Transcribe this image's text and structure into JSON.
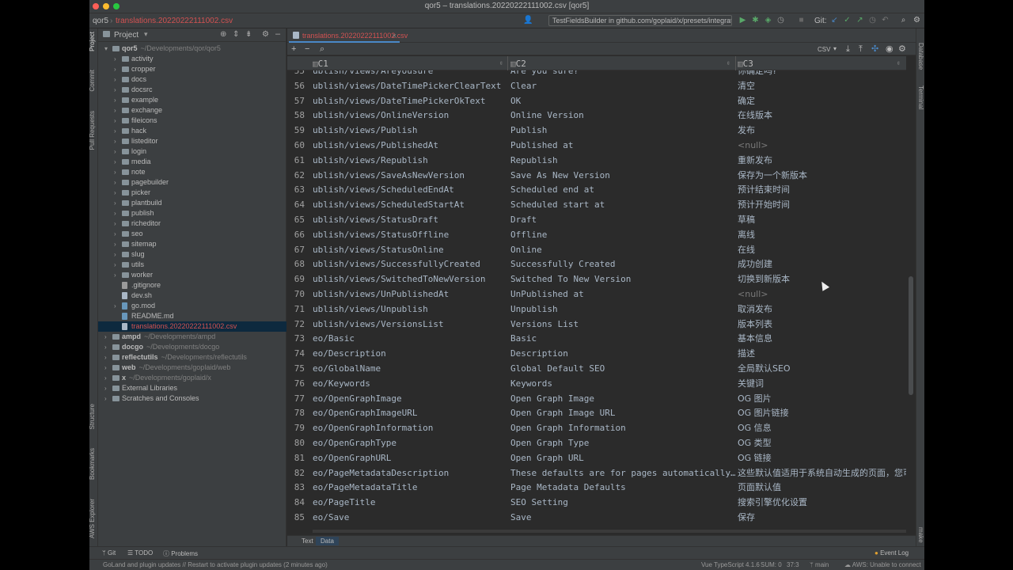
{
  "window": {
    "title": "qor5 – translations.20220222111002.csv [qor5]",
    "breadcrumb_project": "qor5",
    "breadcrumb_file": "translations.20220222111002.csv",
    "run_config": "TestFieldsBuilder in github.com/goplaid/x/presets/integration",
    "git_label": "Git:"
  },
  "left_strip": [
    "Project",
    "Commit",
    "Pull Requests",
    "Structure",
    "Bookmarks",
    "AWS Explorer"
  ],
  "right_strip": [
    "Database",
    "Terminal",
    "make"
  ],
  "project_panel": {
    "title": "Project",
    "root": {
      "name": "qor5",
      "path": "~/Developments/qor/qor5"
    },
    "folders": [
      "activity",
      "cropper",
      "docs",
      "docsrc",
      "example",
      "exchange",
      "fileicons",
      "hack",
      "listeditor",
      "login",
      "media",
      "note",
      "pagebuilder",
      "picker",
      "plantbuild",
      "publish",
      "richeditor",
      "seo",
      "sitemap",
      "slug",
      "utils",
      "worker"
    ],
    "files": [
      ".gitignore",
      "dev.sh",
      "go.mod",
      "README.md",
      "translations.20220222111002.csv"
    ],
    "other_roots": [
      {
        "name": "ampd",
        "path": "~/Developments/ampd"
      },
      {
        "name": "docgo",
        "path": "~/Developments/docgo"
      },
      {
        "name": "reflectutils",
        "path": "~/Developments/reflectutils"
      },
      {
        "name": "web",
        "path": "~/Developments/goplaid/web"
      },
      {
        "name": "x",
        "path": "~/Developments/goplaid/x"
      }
    ],
    "extras": [
      "External Libraries",
      "Scratches and Consoles"
    ]
  },
  "editor": {
    "tab_label": "translations.20220222111002.csv",
    "format": "CSV",
    "columns": [
      "C1",
      "C2",
      "C3"
    ],
    "rows": [
      {
        "n": "55",
        "c1": "ublish/views/Areyousure",
        "c2": "Are you sure?",
        "c3": "你确定吗?"
      },
      {
        "n": "56",
        "c1": "ublish/views/DateTimePickerClearText",
        "c2": "Clear",
        "c3": "清空"
      },
      {
        "n": "57",
        "c1": "ublish/views/DateTimePickerOkText",
        "c2": "OK",
        "c3": "确定"
      },
      {
        "n": "58",
        "c1": "ublish/views/OnlineVersion",
        "c2": "Online Version",
        "c3": "在线版本"
      },
      {
        "n": "59",
        "c1": "ublish/views/Publish",
        "c2": "Publish",
        "c3": "发布"
      },
      {
        "n": "60",
        "c1": "ublish/views/PublishedAt",
        "c2": "Published at",
        "c3": "<null>"
      },
      {
        "n": "61",
        "c1": "ublish/views/Republish",
        "c2": "Republish",
        "c3": "重新发布"
      },
      {
        "n": "62",
        "c1": "ublish/views/SaveAsNewVersion",
        "c2": "Save As New Version",
        "c3": "保存为一个新版本"
      },
      {
        "n": "63",
        "c1": "ublish/views/ScheduledEndAt",
        "c2": "Scheduled end at",
        "c3": "预计结束时间"
      },
      {
        "n": "64",
        "c1": "ublish/views/ScheduledStartAt",
        "c2": "Scheduled start at",
        "c3": "预计开始时间"
      },
      {
        "n": "65",
        "c1": "ublish/views/StatusDraft",
        "c2": "Draft",
        "c3": "草稿"
      },
      {
        "n": "66",
        "c1": "ublish/views/StatusOffline",
        "c2": "Offline",
        "c3": "离线"
      },
      {
        "n": "67",
        "c1": "ublish/views/StatusOnline",
        "c2": "Online",
        "c3": "在线"
      },
      {
        "n": "68",
        "c1": "ublish/views/SuccessfullyCreated",
        "c2": "Successfully Created",
        "c3": "成功创建"
      },
      {
        "n": "69",
        "c1": "ublish/views/SwitchedToNewVersion",
        "c2": "Switched To New Version",
        "c3": "切换到新版本"
      },
      {
        "n": "70",
        "c1": "ublish/views/UnPublishedAt",
        "c2": "UnPublished at",
        "c3": "<null>"
      },
      {
        "n": "71",
        "c1": "ublish/views/Unpublish",
        "c2": "Unpublish",
        "c3": "取消发布"
      },
      {
        "n": "72",
        "c1": "ublish/views/VersionsList",
        "c2": "Versions List",
        "c3": "版本列表"
      },
      {
        "n": "73",
        "c1": "eo/Basic",
        "c2": "Basic",
        "c3": "基本信息"
      },
      {
        "n": "74",
        "c1": "eo/Description",
        "c2": "Description",
        "c3": "描述"
      },
      {
        "n": "75",
        "c1": "eo/GlobalName",
        "c2": "Global Default SEO",
        "c3": "全局默认SEO"
      },
      {
        "n": "76",
        "c1": "eo/Keywords",
        "c2": "Keywords",
        "c3": "关键词"
      },
      {
        "n": "77",
        "c1": "eo/OpenGraphImage",
        "c2": "Open Graph Image",
        "c3": "OG 图片"
      },
      {
        "n": "78",
        "c1": "eo/OpenGraphImageURL",
        "c2": "Open Graph Image URL",
        "c3": "OG 图片链接"
      },
      {
        "n": "79",
        "c1": "eo/OpenGraphInformation",
        "c2": "Open Graph Information",
        "c3": "OG 信息"
      },
      {
        "n": "80",
        "c1": "eo/OpenGraphType",
        "c2": "Open Graph Type",
        "c3": "OG 类型"
      },
      {
        "n": "81",
        "c1": "eo/OpenGraphURL",
        "c2": "Open Graph URL",
        "c3": "OG 链接"
      },
      {
        "n": "82",
        "c1": "eo/PageMetadataDescription",
        "c2": "These defaults are for pages automatically…",
        "c3": "这些默认值适用于系统自动生成的页面，您可"
      },
      {
        "n": "83",
        "c1": "eo/PageMetadataTitle",
        "c2": "Page Metadata Defaults",
        "c3": "页面默认值"
      },
      {
        "n": "84",
        "c1": "eo/PageTitle",
        "c2": "SEO Setting",
        "c3": "搜索引擎优化设置"
      },
      {
        "n": "85",
        "c1": "eo/Save",
        "c2": "Save",
        "c3": "保存"
      }
    ],
    "subtabs": [
      "Text",
      "Data"
    ]
  },
  "tool_windows": {
    "git": "Git",
    "todo": "TODO",
    "problems": "Problems",
    "event_log": "Event Log"
  },
  "status": {
    "message": "GoLand and plugin updates // Restart to activate plugin updates (2 minutes ago)",
    "typescript": "Vue TypeScript 4.1.6",
    "sum": "SUM: 0",
    "position": "37:3",
    "branch": "main",
    "aws": "AWS: Unable to connect"
  }
}
